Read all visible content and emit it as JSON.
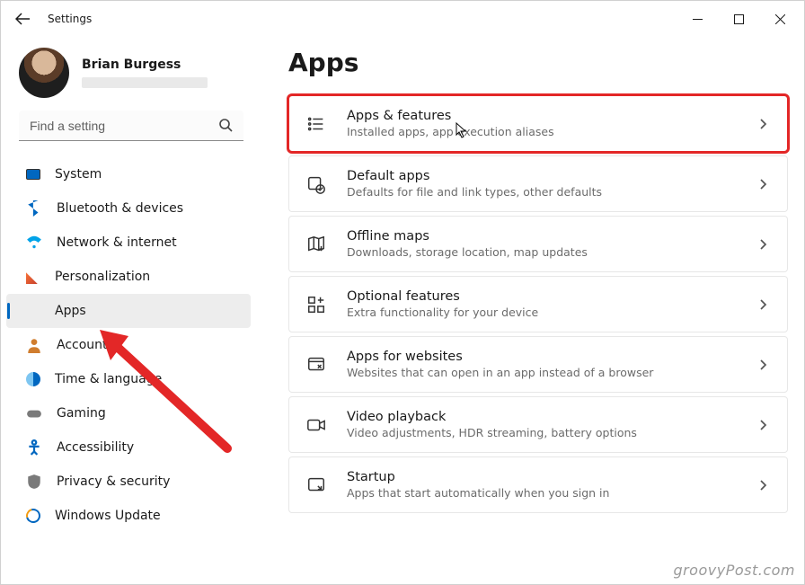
{
  "titlebar": {
    "title": "Settings"
  },
  "profile": {
    "name": "Brian Burgess"
  },
  "search": {
    "placeholder": "Find a setting"
  },
  "sidebar": {
    "items": [
      {
        "label": "System"
      },
      {
        "label": "Bluetooth & devices"
      },
      {
        "label": "Network & internet"
      },
      {
        "label": "Personalization"
      },
      {
        "label": "Apps"
      },
      {
        "label": "Accounts"
      },
      {
        "label": "Time & language"
      },
      {
        "label": "Gaming"
      },
      {
        "label": "Accessibility"
      },
      {
        "label": "Privacy & security"
      },
      {
        "label": "Windows Update"
      }
    ]
  },
  "main": {
    "heading": "Apps",
    "items": [
      {
        "title": "Apps & features",
        "desc": "Installed apps, app execution aliases"
      },
      {
        "title": "Default apps",
        "desc": "Defaults for file and link types, other defaults"
      },
      {
        "title": "Offline maps",
        "desc": "Downloads, storage location, map updates"
      },
      {
        "title": "Optional features",
        "desc": "Extra functionality for your device"
      },
      {
        "title": "Apps for websites",
        "desc": "Websites that can open in an app instead of a browser"
      },
      {
        "title": "Video playback",
        "desc": "Video adjustments, HDR streaming, battery options"
      },
      {
        "title": "Startup",
        "desc": "Apps that start automatically when you sign in"
      }
    ]
  },
  "watermark": "groovyPost.com"
}
